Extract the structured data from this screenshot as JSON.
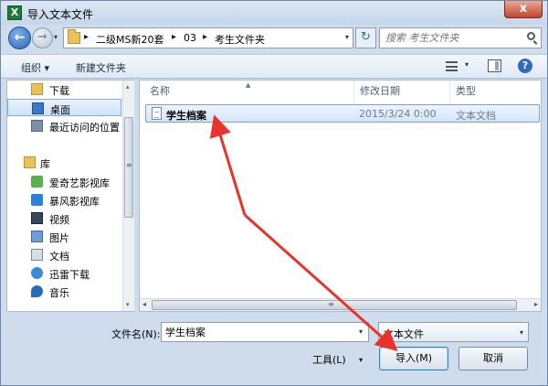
{
  "window": {
    "title": "导入文本文件",
    "app_icon": "X",
    "close": "x"
  },
  "nav": {
    "back": "←",
    "forward": "→",
    "dropdown": "▾",
    "breadcrumbs": [
      "二级MS新20套",
      "03",
      "考生文件夹"
    ],
    "separator": "▸",
    "refresh": "↻",
    "search_placeholder": "搜索 考生文件夹"
  },
  "toolbar": {
    "organize": "组织 ▾",
    "new_folder": "新建文件夹",
    "dropdown": "▾",
    "help": "?"
  },
  "sidebar": {
    "favorites": [
      {
        "label": "下载",
        "icon": "download-folder-icon",
        "color": "#e7c35a"
      },
      {
        "label": "桌面",
        "icon": "desktop-icon",
        "color": "#3b78c8",
        "selected": true
      },
      {
        "label": "最近访问的位置",
        "icon": "recent-places-icon",
        "color": "#7d8fa8"
      }
    ],
    "library_header": "库",
    "libraries": [
      {
        "label": "爱奇艺影视库",
        "icon": "iqiyi-icon",
        "color": "#5ab14a"
      },
      {
        "label": "暴风影视库",
        "icon": "baofeng-icon",
        "color": "#2d7fd8"
      },
      {
        "label": "视频",
        "icon": "video-icon",
        "color": "#39475a"
      },
      {
        "label": "图片",
        "icon": "picture-icon",
        "color": "#6a9ed4"
      },
      {
        "label": "文档",
        "icon": "documents-icon",
        "color": "#d8dee6"
      },
      {
        "label": "迅雷下载",
        "icon": "thunder-icon",
        "color": "#3b88d6"
      },
      {
        "label": "音乐",
        "icon": "music-icon",
        "color": "#2b6bb8"
      }
    ],
    "scroll_up": "▴",
    "scroll_down": "▾",
    "scroll_grip": "≡"
  },
  "filelist": {
    "columns": [
      "名称",
      "修改日期",
      "类型"
    ],
    "sort_indicator": "▲",
    "rows": [
      {
        "name": "学生档案",
        "modified": "2015/3/24 0:00",
        "type": "文本文档"
      }
    ],
    "scroll_left": "◂",
    "scroll_right": "▸",
    "scroll_grip": "≡"
  },
  "footer": {
    "filename_label": "文件名(N):",
    "filename_value": "学生档案",
    "filetype_value": "文本文件",
    "tools_label": "工具(L)",
    "dropdown": "▾",
    "import_label": "导入(M)",
    "cancel_label": "取消"
  },
  "colors": {
    "annotation": "#e8322a",
    "selection": "#cfe2f7",
    "title_bg": "#c5d6ea"
  }
}
